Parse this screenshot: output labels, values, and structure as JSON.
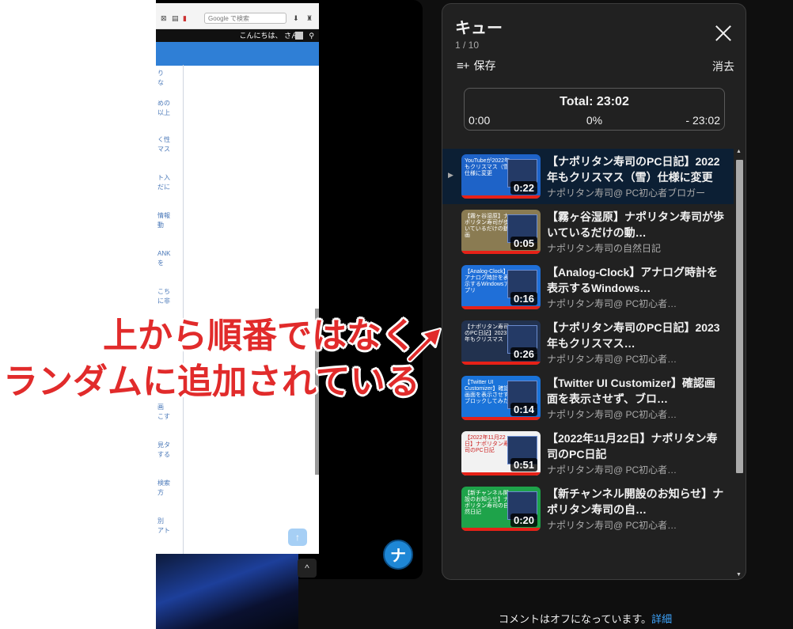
{
  "left_window": {
    "search_placeholder": "Google で検索",
    "greeting": "こんにちは、 さん",
    "sidebar_texts": [
      "り",
      "な",
      "めの",
      "以上",
      "く性",
      "マス",
      "ト入",
      "だに",
      "情報",
      "動",
      "ANK",
      "を",
      "こち",
      "に非",
      "画",
      "こす",
      "見タ",
      "する",
      "検索",
      "方",
      "別",
      "アト"
    ],
    "up_button": "↑",
    "chevron": "^",
    "avatar_letter": "ナ"
  },
  "queue": {
    "title": "キュー",
    "position": "1 / 10",
    "save_label": "保存",
    "clear_label": "消去",
    "total_label": "Total: 23:02",
    "elapsed": "0:00",
    "percent": "0%",
    "remaining": "- 23:02",
    "items": [
      {
        "title": "【ナポリタン寿司のPC日記】2022年もクリスマス（雪）仕様に変更",
        "channel": "ナポリタン寿司@ PC初心者ブロガー",
        "duration": "0:22",
        "thumb_text": "YouTubeが2022年もクリスマス（雪）仕様に変更",
        "active": true,
        "thumb_bg": "#1e63c8"
      },
      {
        "title": "【霧ヶ谷湿原】ナポリタン寿司が歩いているだけの動…",
        "channel": "ナポリタン寿司の自然日記",
        "duration": "0:05",
        "thumb_text": "【霧ヶ谷湿原】ナポリタン寿司が歩いているだけの動画",
        "active": false,
        "thumb_bg": "#8a7b52"
      },
      {
        "title": "【Analog-Clock】アナログ時計を表示するWindows…",
        "channel": "ナポリタン寿司@ PC初心者…",
        "duration": "0:16",
        "thumb_text": "【Analog-Clock】アナログ時計を表示するWindowsアプリ",
        "active": false,
        "thumb_bg": "#1f6fd8"
      },
      {
        "title": "【ナポリタン寿司のPC日記】2023年もクリスマス…",
        "channel": "ナポリタン寿司@ PC初心者…",
        "duration": "0:26",
        "thumb_text": "【ナポリタン寿司のPC日記】2023年もクリスマス",
        "active": false,
        "thumb_bg": "#22324f"
      },
      {
        "title": "【Twitter UI Customizer】確認画面を表示させず、ブロ…",
        "channel": "ナポリタン寿司@ PC初心者…",
        "duration": "0:14",
        "thumb_text": "【Twitter UI Customizer】確認画面を表示させずブロックしてみた",
        "active": false,
        "thumb_bg": "#1a73d9"
      },
      {
        "title": "【2022年11月22日】ナポリタン寿司のPC日記",
        "channel": "ナポリタン寿司@ PC初心者…",
        "duration": "0:51",
        "thumb_text": "【2022年11月22日】ナポリタン寿司のPC日記",
        "active": false,
        "thumb_bg": "#f2f2f2"
      },
      {
        "title": "【新チャンネル開設のお知らせ】ナポリタン寿司の自…",
        "channel": "ナポリタン寿司@ PC初心者…",
        "duration": "0:20",
        "thumb_text": "【新チャンネル開設のお知らせ】ナポリタン寿司の自然日記",
        "active": false,
        "thumb_bg": "#1ea34a"
      }
    ],
    "scroll_up": "▲",
    "scroll_down": "▼"
  },
  "comments": {
    "text": "コメントはオフになっています。",
    "link": "詳細"
  },
  "annotation": {
    "line1": "上から順番ではなく",
    "line2": "ランダムに追加されている",
    "color": "#e12b2b"
  }
}
